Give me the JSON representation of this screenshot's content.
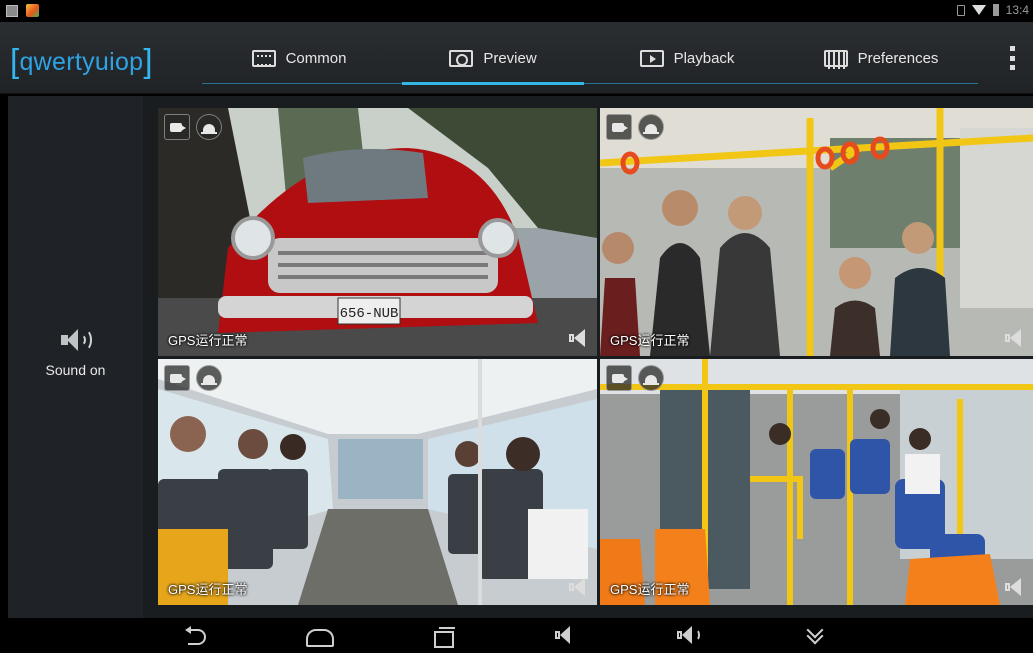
{
  "status_bar": {
    "time": "13:4",
    "icons": [
      "gallery-icon",
      "app-icon",
      "sim-icon",
      "wifi-icon",
      "battery-icon"
    ]
  },
  "app": {
    "title": "qwertyuiop",
    "accent_color": "#33b5e5"
  },
  "tabs": [
    {
      "label": "Common",
      "icon": "common-icon",
      "active": false
    },
    {
      "label": "Preview",
      "icon": "preview-icon",
      "active": true
    },
    {
      "label": "Playback",
      "icon": "playback-icon",
      "active": false
    },
    {
      "label": "Preferences",
      "icon": "preferences-icon",
      "active": false
    }
  ],
  "sidebar": {
    "sound_label": "Sound on",
    "sound_icon": "speaker-on-icon"
  },
  "channels": [
    {
      "gps_status": "GPS运行正常",
      "scene": "red vintage car on street"
    },
    {
      "gps_status": "GPS运行正常",
      "scene": "passengers standing in bus"
    },
    {
      "gps_status": "GPS运行正常",
      "scene": "bus interior seated passengers"
    },
    {
      "gps_status": "GPS运行正常",
      "scene": "bus interior yellow poles orange seats"
    }
  ],
  "nav_bar": {
    "buttons": [
      "back",
      "home",
      "recent-apps",
      "volume-down",
      "volume-up",
      "more"
    ]
  }
}
